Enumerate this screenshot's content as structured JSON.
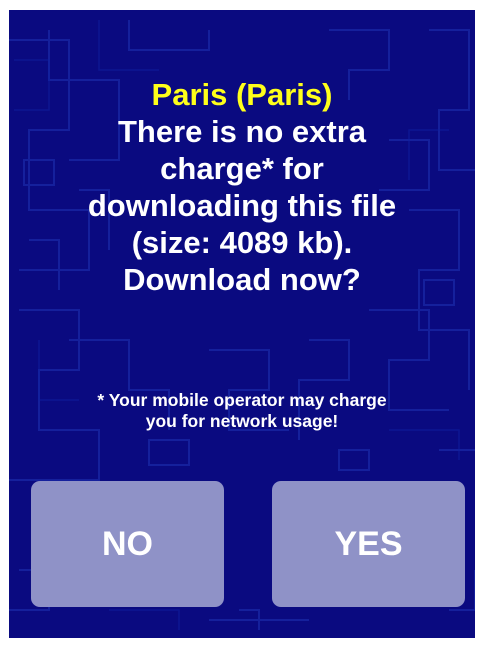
{
  "dialog": {
    "title": "Paris (Paris)",
    "message_lines": [
      "There is no extra",
      "charge* for",
      "downloading this file",
      "(size: 4089 kb).",
      "Download now?"
    ],
    "disclaimer_lines": [
      "* Your mobile operator may charge",
      "you for network usage!"
    ]
  },
  "buttons": {
    "no_label": "NO",
    "yes_label": "YES"
  },
  "colors": {
    "background": "#0a0a80",
    "title": "#ffff1a",
    "text": "#ffffff",
    "button": "#8f92c7"
  }
}
